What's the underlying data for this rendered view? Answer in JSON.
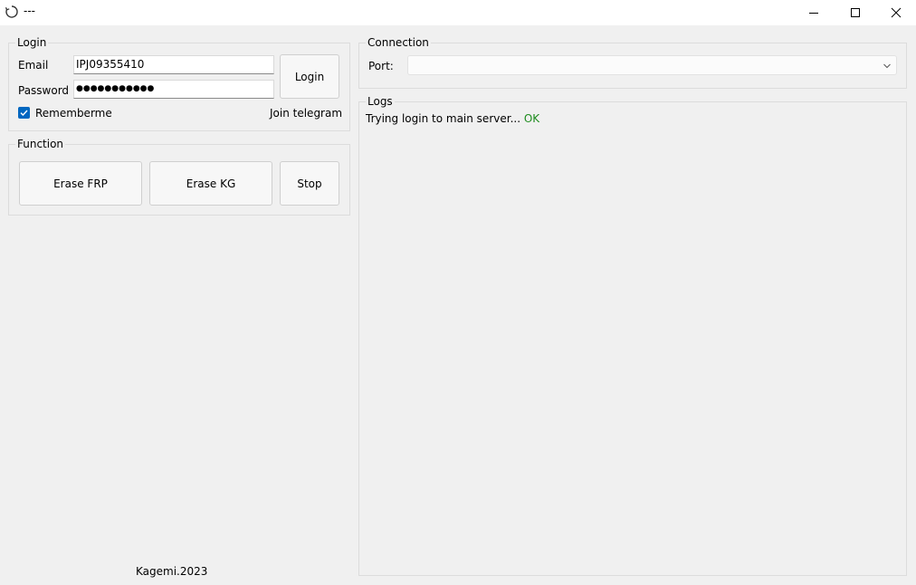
{
  "window": {
    "title": "---"
  },
  "login": {
    "group_title": "Login",
    "email_label": "Email",
    "email_value": "IPJ09355410",
    "password_label": "Password",
    "password_masked": "●●●●●●●●●●●",
    "login_button": "Login",
    "remember_label": "Rememberme",
    "remember_checked": true,
    "telegram_label": "Join telegram"
  },
  "function": {
    "group_title": "Function",
    "erase_frp_button": "Erase FRP",
    "erase_kg_button": "Erase KG",
    "stop_button": "Stop"
  },
  "connection": {
    "group_title": "Connection",
    "port_label": "Port:",
    "port_value": ""
  },
  "logs": {
    "group_title": "Logs",
    "line1_text": "Trying login to main server... ",
    "line1_status": "OK",
    "status_color": "#1e8c1e"
  },
  "footer": {
    "credit": "Kagemi.2023"
  },
  "colors": {
    "accent": "#0067c0",
    "window_bg": "#f0f0f0"
  }
}
